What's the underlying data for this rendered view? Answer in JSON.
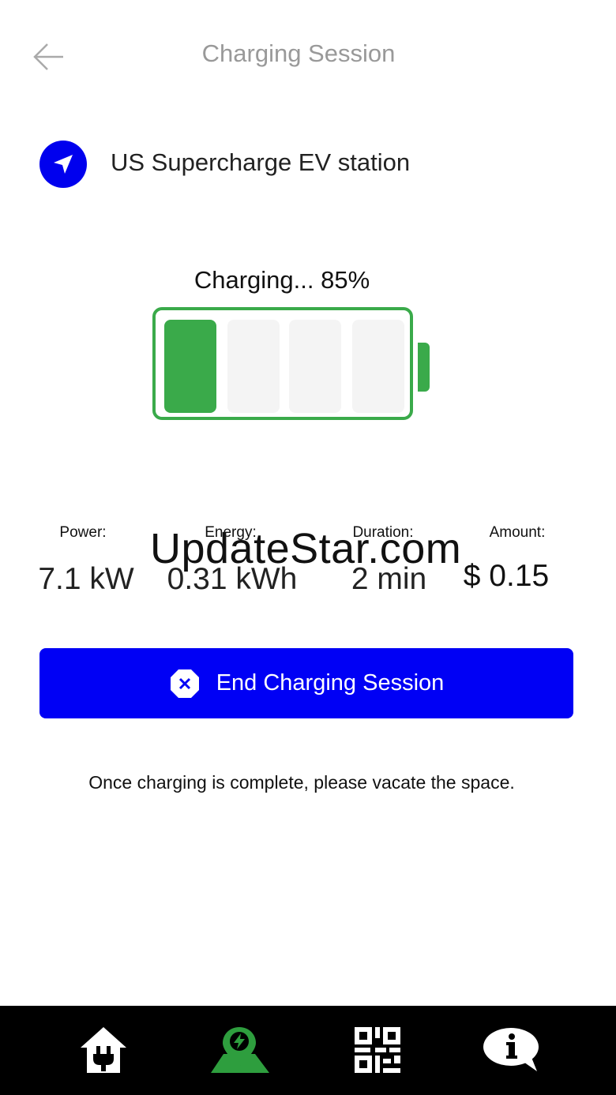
{
  "header": {
    "title": "Charging Session"
  },
  "station": {
    "name": "US Supercharge EV station"
  },
  "charging": {
    "status_label": "Charging... 85%",
    "level_percent": 85,
    "cells_total": 4,
    "cells_filled": 1
  },
  "stats": [
    {
      "label": "Power:",
      "value": "7.1 kW"
    },
    {
      "label": "Energy:",
      "value": "0.31 kWh"
    },
    {
      "label": "Duration:",
      "value": "2 min"
    },
    {
      "label": "Amount:",
      "value": "$ 0.15"
    }
  ],
  "watermark": "UpdateStar.com",
  "actions": {
    "end_session_label": "End Charging Session"
  },
  "note": "Once charging is complete, please vacate the space.",
  "bottom_nav": [
    {
      "icon": "home-plug-icon"
    },
    {
      "icon": "map-charging-pin-icon"
    },
    {
      "icon": "qr-code-icon"
    },
    {
      "icon": "info-bubble-icon"
    }
  ],
  "colors": {
    "primary": "#0000f5",
    "battery_green": "#3aaa4a",
    "nav_bg": "#000000",
    "map_pin_green": "#2e9e3e"
  }
}
